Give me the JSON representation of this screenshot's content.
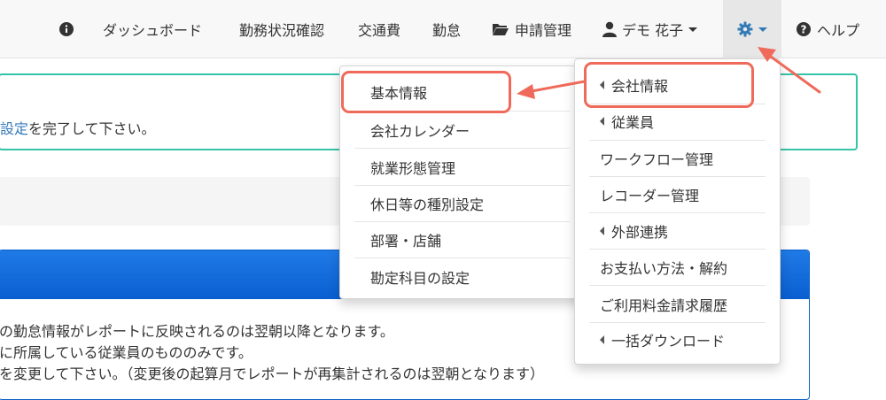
{
  "navbar": {
    "items": [
      {
        "label": "ダッシュボード"
      },
      {
        "label": "勤務状況確認"
      },
      {
        "label": "交通費"
      },
      {
        "label": "勤怠"
      },
      {
        "label": "申請管理"
      },
      {
        "label": "デモ 花子"
      },
      {
        "label": "ヘルプ"
      }
    ],
    "colors": {
      "accent": "#337ab7",
      "highlight": "#ef6a5a"
    }
  },
  "background": {
    "alert_link": "設定",
    "alert_rest": "を完了して下さい。",
    "panel_lines": [
      "の勤怠情報がレポートに反映されるのは翌朝以降となります。",
      "に所属している従業員のもののみです。",
      "を変更して下さい。（変更後の起算月でレポートが再集計されるのは翌朝となります）"
    ]
  },
  "settings_menu": {
    "items": [
      {
        "label": "会社情報",
        "submenu": true
      },
      {
        "label": "従業員",
        "submenu": true
      },
      {
        "label": "ワークフロー管理",
        "submenu": false
      },
      {
        "label": "レコーダー管理",
        "submenu": false
      },
      {
        "label": "外部連携",
        "submenu": true
      },
      {
        "label": "お支払い方法・解約",
        "submenu": false
      },
      {
        "label": "ご利用料金請求履歴",
        "submenu": false
      },
      {
        "label": "一括ダウンロード",
        "submenu": true
      }
    ]
  },
  "company_submenu": {
    "items": [
      {
        "label": "基本情報"
      },
      {
        "label": "会社カレンダー"
      },
      {
        "label": "就業形態管理"
      },
      {
        "label": "休日等の種別設定"
      },
      {
        "label": "部署・店舗"
      },
      {
        "label": "勘定科目の設定"
      }
    ]
  }
}
